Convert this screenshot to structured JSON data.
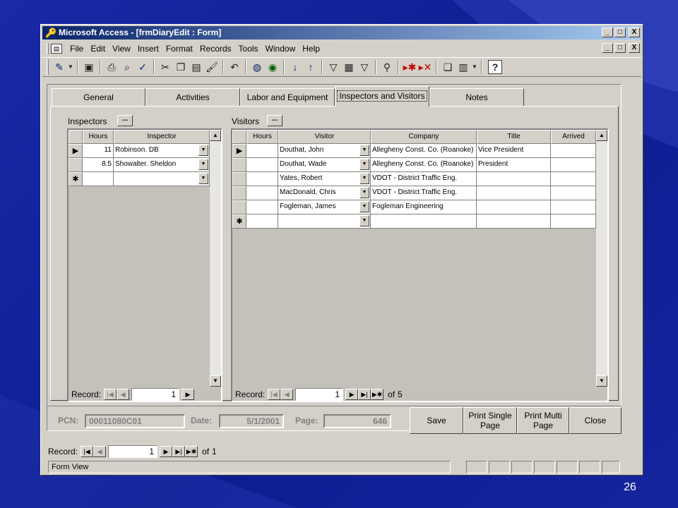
{
  "window": {
    "title": "Microsoft Access - [frmDiaryEdit : Form]",
    "controls": {
      "minimize": "_",
      "restore": "□",
      "close": "X"
    }
  },
  "menu": {
    "items": [
      "File",
      "Edit",
      "View",
      "Insert",
      "Format",
      "Records",
      "Tools",
      "Window",
      "Help"
    ]
  },
  "tabs": [
    {
      "label": "General",
      "active": false
    },
    {
      "label": "Activities",
      "active": false
    },
    {
      "label": "Labor and Equipment",
      "active": false
    },
    {
      "label": "Inspectors and Visitors",
      "active": true
    },
    {
      "label": "Notes",
      "active": false
    }
  ],
  "inspectors": {
    "label": "Inspectors",
    "ellipsis": "...",
    "columns": [
      "Hours",
      "Inspector"
    ],
    "rows": [
      {
        "hours": "11",
        "inspector": "Robinson. DB"
      },
      {
        "hours": "8.5",
        "inspector": "Showalter. Sheldon"
      }
    ],
    "nav": {
      "label": "Record:",
      "current": "1"
    }
  },
  "visitors": {
    "label": "Visitors",
    "ellipsis": "...",
    "columns": [
      "Hours",
      "Visitor",
      "Company",
      "Title",
      "Arrived"
    ],
    "rows": [
      {
        "hours": "",
        "visitor": "Douthat, John",
        "company": "Allegheny Const. Co. (Roanoke)",
        "title": "Vice President",
        "arrived": ""
      },
      {
        "hours": "",
        "visitor": "Douthat, Wade",
        "company": "Allegheny Const. Co. (Roanoke)",
        "title": "President",
        "arrived": ""
      },
      {
        "hours": "",
        "visitor": "Yates, Robert",
        "company": "VDOT - District Traffic Eng.",
        "title": "",
        "arrived": ""
      },
      {
        "hours": "",
        "visitor": "MacDonald, Chris",
        "company": "VDOT - District Traffic Eng.",
        "title": "",
        "arrived": ""
      },
      {
        "hours": "",
        "visitor": "Fogleman, James",
        "company": "Fogleman Engineering",
        "title": "",
        "arrived": ""
      }
    ],
    "nav": {
      "label": "Record:",
      "current": "1",
      "of": "of",
      "total": "5"
    }
  },
  "footer": {
    "pcn_label": "PCN:",
    "pcn_value": "00011080C01",
    "date_label": "Date:",
    "date_value": "5/1/2001",
    "page_label": "Page:",
    "page_value": "646",
    "buttons": {
      "save": "Save",
      "print_single": "Print Single Page",
      "print_multi": "Print Multi Page",
      "close": "Close"
    }
  },
  "form_nav": {
    "label": "Record:",
    "current": "1",
    "of": "of",
    "total": "1"
  },
  "status": {
    "text": "Form View"
  },
  "slide": {
    "number": "26"
  },
  "colors": {
    "titlebar_start": "#0a246a",
    "titlebar_end": "#a6caf0",
    "face": "#d4d0c8",
    "slide_bg": "#1a2aa6"
  },
  "icons": [
    "form-view-icon",
    "save-icon",
    "print-icon",
    "print-preview-icon",
    "spelling-icon",
    "cut-icon",
    "copy-icon",
    "paste-icon",
    "format-painter-icon",
    "undo-icon",
    "hyperlink-icon",
    "web-toolbar-icon",
    "sort-ascending-icon",
    "sort-descending-icon",
    "filter-by-selection-icon",
    "filter-by-form-icon",
    "apply-filter-icon",
    "find-icon",
    "new-record-icon",
    "delete-record-icon",
    "properties-icon",
    "new-object-icon",
    "help-icon"
  ]
}
